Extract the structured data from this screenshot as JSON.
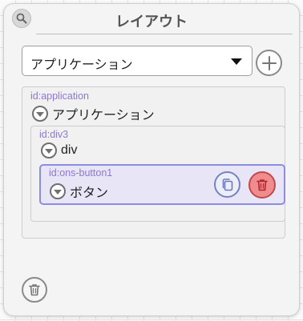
{
  "panel": {
    "title": "レイアウト",
    "zoom_icon": "magnifier-icon"
  },
  "selector": {
    "value": "アプリケーション",
    "caret_icon": "caret-down-icon",
    "add_icon": "plus-circle-icon"
  },
  "tree": {
    "application": {
      "id": "id:application",
      "label": "アプリケーション"
    },
    "div3": {
      "id": "id:div3",
      "label": "div"
    },
    "button1": {
      "id": "id:ons-button1",
      "label": "ボタン",
      "selected": true,
      "actions": {
        "copy_icon": "copy-icon",
        "delete_icon": "trash-icon"
      }
    }
  },
  "footer": {
    "trash_icon": "trash-icon"
  },
  "colors": {
    "id_label": "#8d78d6",
    "selected_border": "#8b8de3",
    "selected_bg": "#e8e6f6",
    "copy_accent": "#7583c4",
    "delete_accent": "#c4484b",
    "delete_fill": "#f08b8e"
  }
}
